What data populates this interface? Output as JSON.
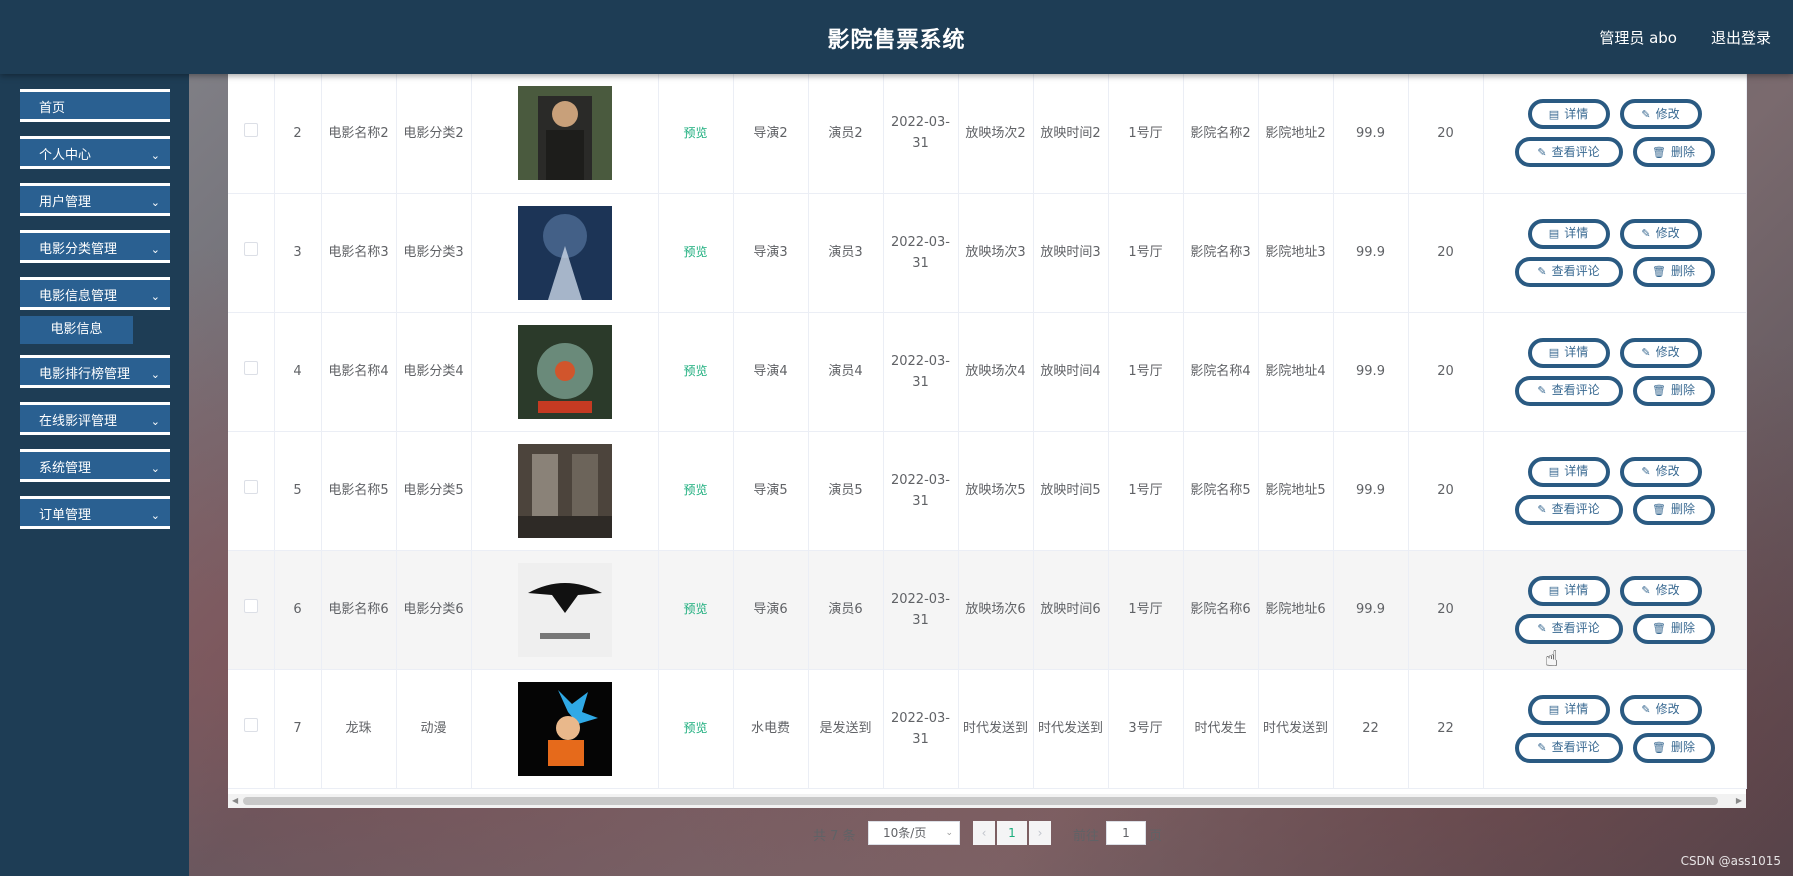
{
  "header": {
    "title": "影院售票系统",
    "user": "管理员 abo",
    "logout": "退出登录"
  },
  "sidebar": {
    "items": [
      {
        "label": "首页",
        "has_arrow": false
      },
      {
        "label": "个人中心",
        "has_arrow": true
      },
      {
        "label": "用户管理",
        "has_arrow": true
      },
      {
        "label": "电影分类管理",
        "has_arrow": true
      },
      {
        "label": "电影信息管理",
        "has_arrow": true
      },
      {
        "label": "电影排行榜管理",
        "has_arrow": true
      },
      {
        "label": "在线影评管理",
        "has_arrow": true
      },
      {
        "label": "系统管理",
        "has_arrow": true
      },
      {
        "label": "订单管理",
        "has_arrow": true
      }
    ],
    "submenu": "电影信息"
  },
  "table": {
    "buttons": {
      "detail": "详情",
      "edit": "修改",
      "comments": "查看评论",
      "delete": "删除"
    },
    "rows": [
      {
        "idx": "2",
        "name": "电影名称2",
        "category": "电影分类2",
        "preview": "预览",
        "director": "导演2",
        "actor": "演员2",
        "date": "2022-03-31",
        "session": "放映场次2",
        "time": "放映时间2",
        "hall": "1号厅",
        "cinema": "影院名称2",
        "address": "影院地址2",
        "price": "99.9",
        "seats": "20",
        "poster": "poster-2"
      },
      {
        "idx": "3",
        "name": "电影名称3",
        "category": "电影分类3",
        "preview": "预览",
        "director": "导演3",
        "actor": "演员3",
        "date": "2022-03-31",
        "session": "放映场次3",
        "time": "放映时间3",
        "hall": "1号厅",
        "cinema": "影院名称3",
        "address": "影院地址3",
        "price": "99.9",
        "seats": "20",
        "poster": "poster-3"
      },
      {
        "idx": "4",
        "name": "电影名称4",
        "category": "电影分类4",
        "preview": "预览",
        "director": "导演4",
        "actor": "演员4",
        "date": "2022-03-31",
        "session": "放映场次4",
        "time": "放映时间4",
        "hall": "1号厅",
        "cinema": "影院名称4",
        "address": "影院地址4",
        "price": "99.9",
        "seats": "20",
        "poster": "poster-4"
      },
      {
        "idx": "5",
        "name": "电影名称5",
        "category": "电影分类5",
        "preview": "预览",
        "director": "导演5",
        "actor": "演员5",
        "date": "2022-03-31",
        "session": "放映场次5",
        "time": "放映时间5",
        "hall": "1号厅",
        "cinema": "影院名称5",
        "address": "影院地址5",
        "price": "99.9",
        "seats": "20",
        "poster": "poster-5"
      },
      {
        "idx": "6",
        "name": "电影名称6",
        "category": "电影分类6",
        "preview": "预览",
        "director": "导演6",
        "actor": "演员6",
        "date": "2022-03-31",
        "session": "放映场次6",
        "time": "放映时间6",
        "hall": "1号厅",
        "cinema": "影院名称6",
        "address": "影院地址6",
        "price": "99.9",
        "seats": "20",
        "poster": "poster-6"
      },
      {
        "idx": "7",
        "name": "龙珠",
        "category": "动漫",
        "preview": "预览",
        "director": "水电费",
        "actor": "是发送到",
        "date": "2022-03-31",
        "session": "时代发送到",
        "time": "时代发送到",
        "hall": "3号厅",
        "cinema": "时代发生",
        "address": "时代发送到",
        "price": "22",
        "seats": "22",
        "poster": "poster-7"
      }
    ]
  },
  "pagination": {
    "total": "共 7 条",
    "page_size": "10条/页",
    "current": "1",
    "goto_prefix": "前往",
    "goto_value": "1",
    "goto_suffix": "页"
  },
  "watermark": "CSDN @ass1015"
}
